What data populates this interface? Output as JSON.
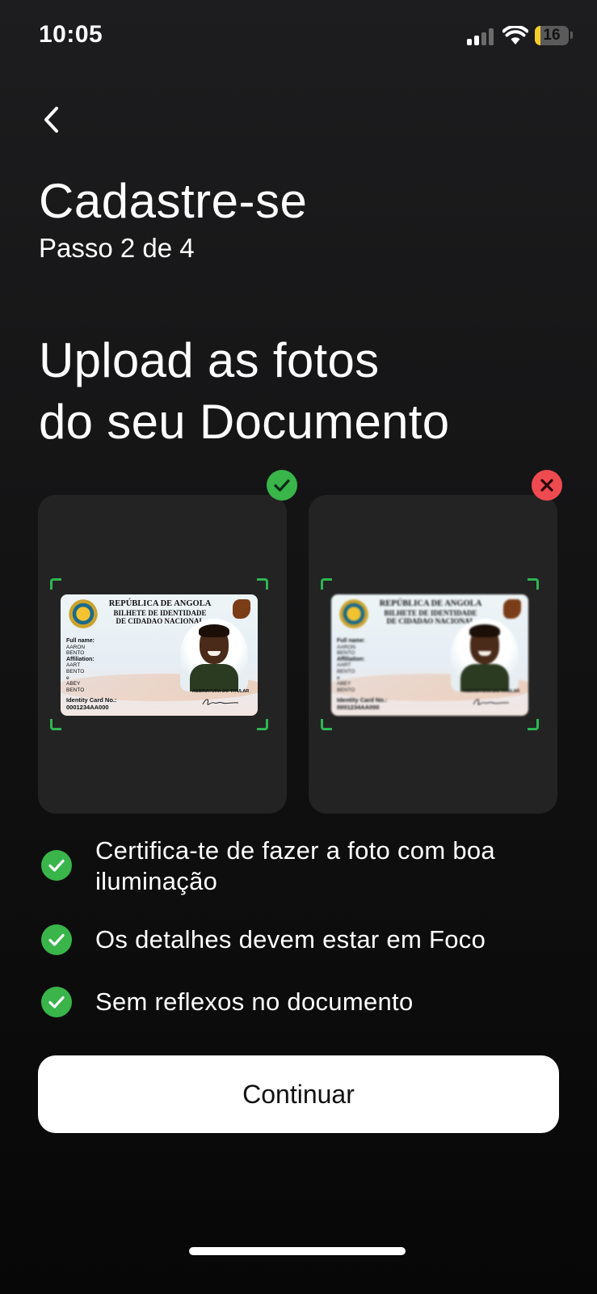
{
  "status_bar": {
    "time": "10:05",
    "battery": "16",
    "battery_fraction": 0.16
  },
  "header": {
    "title": "Cadastre-se",
    "step": "Passo 2 de 4"
  },
  "heading": {
    "line1": "Upload as fotos",
    "line2": "do seu Documento"
  },
  "id_card": {
    "republic": "REPÚBLICA DE ANGOLA",
    "doc_line1": "BILHETE DE IDENTIDADE",
    "doc_line2": "DE CIDADAO NACIONAL",
    "full_name_label": "Full name:",
    "name_1": "AARON",
    "name_2": "BENTO",
    "affiliation_label": "Affiliation:",
    "aff_1": "AART",
    "aff_2": "BENTO",
    "aff_3": "e",
    "aff_4": "ABEY",
    "aff_5": "BENTO",
    "id_label": "Identity Card No.:",
    "id_number": "0001234AA000",
    "signature_caption": "ASSINATURA DO TITULAR"
  },
  "photos": [
    {
      "side": "front",
      "status": "accepted",
      "icon": "check-icon",
      "color": "#39b54a"
    },
    {
      "side": "back",
      "status": "rejected",
      "icon": "close-icon",
      "color": "#ef4a4f"
    }
  ],
  "checklist": [
    {
      "line1": "Certifica-te de fazer a foto com boa",
      "line2": "iluminação"
    },
    {
      "line1": "Os detalhes devem estar em Foco"
    },
    {
      "line1": "Sem reflexos no documento"
    }
  ],
  "continue_label": "Continuar",
  "colors": {
    "accent": "#39b54a",
    "error": "#ef4a4f",
    "frame": "#2fb551",
    "background": "#141415"
  }
}
